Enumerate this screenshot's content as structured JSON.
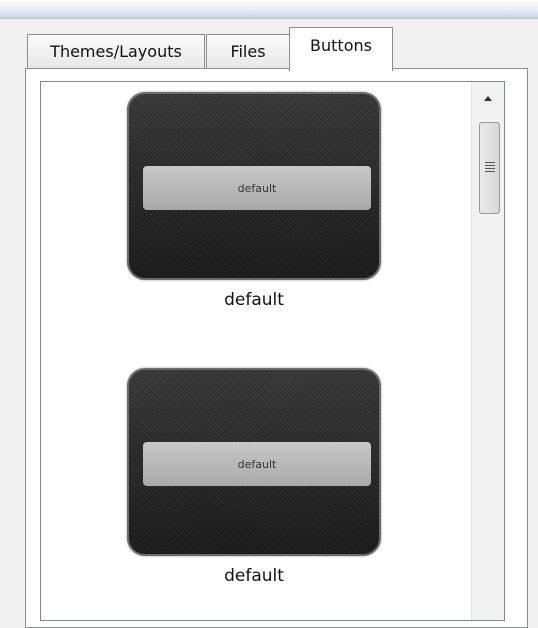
{
  "tabs": [
    {
      "label": "Themes/Layouts"
    },
    {
      "label": "Files"
    },
    {
      "label": "Buttons",
      "active": true
    }
  ],
  "buttons_list": {
    "items": [
      {
        "preview_label": "default",
        "caption": "default"
      },
      {
        "preview_label": "default",
        "caption": "default"
      }
    ]
  }
}
